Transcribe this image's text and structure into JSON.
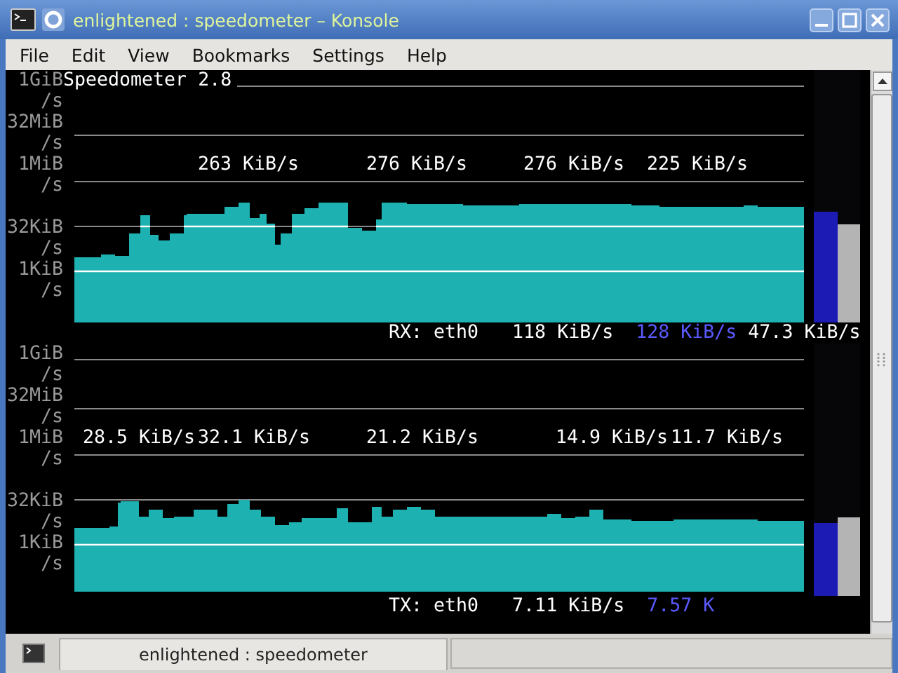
{
  "window": {
    "title": "enlightened : speedometer – Konsole"
  },
  "menu": [
    "File",
    "Edit",
    "View",
    "Bookmarks",
    "Settings",
    "Help"
  ],
  "terminal": {
    "title": "Speedometer 2.8",
    "panels": [
      {
        "ticks": [
          {
            "label": "1GiB",
            "unit": "/s"
          },
          {
            "label": "32MiB",
            "unit": "/s"
          },
          {
            "label": "1MiB",
            "unit": "/s"
          },
          {
            "label": "32KiB",
            "unit": "/s"
          },
          {
            "label": "1KiB",
            "unit": "/s"
          }
        ],
        "peaks": [
          "263 KiB/s",
          "276 KiB/s",
          "276 KiB/s",
          "225 KiB/s"
        ],
        "status": {
          "interface": "RX: eth0",
          "reading_1": "118 KiB/s",
          "reading_2": "128 KiB/s",
          "reading_3": "47.3 KiB/s"
        },
        "bars": [
          {
            "level": 0.44,
            "color": "#1c1cb4"
          },
          {
            "level": 0.39,
            "color": "#b4b4b4"
          }
        ]
      },
      {
        "ticks": [
          {
            "label": "1GiB",
            "unit": "/s"
          },
          {
            "label": "32MiB",
            "unit": "/s"
          },
          {
            "label": "1MiB",
            "unit": "/s"
          },
          {
            "label": "32KiB",
            "unit": "/s"
          },
          {
            "label": "1KiB",
            "unit": "/s"
          }
        ],
        "peaks": [
          "28.5 KiB/s",
          "32.1 KiB/s",
          "21.2 KiB/s",
          "14.9 KiB/s",
          "11.7 KiB/s"
        ],
        "status": {
          "interface": "TX: eth0",
          "reading_1": "7.11 KiB/s",
          "reading_2": "7.57 K"
        },
        "bars": [
          {
            "level": 0.29,
            "color": "#1c1cb4"
          },
          {
            "level": 0.31,
            "color": "#b4b4b4"
          }
        ]
      }
    ]
  },
  "tab_bar": {
    "tabs": [
      {
        "label": "enlightened : speedometer",
        "selected": true
      }
    ]
  }
}
